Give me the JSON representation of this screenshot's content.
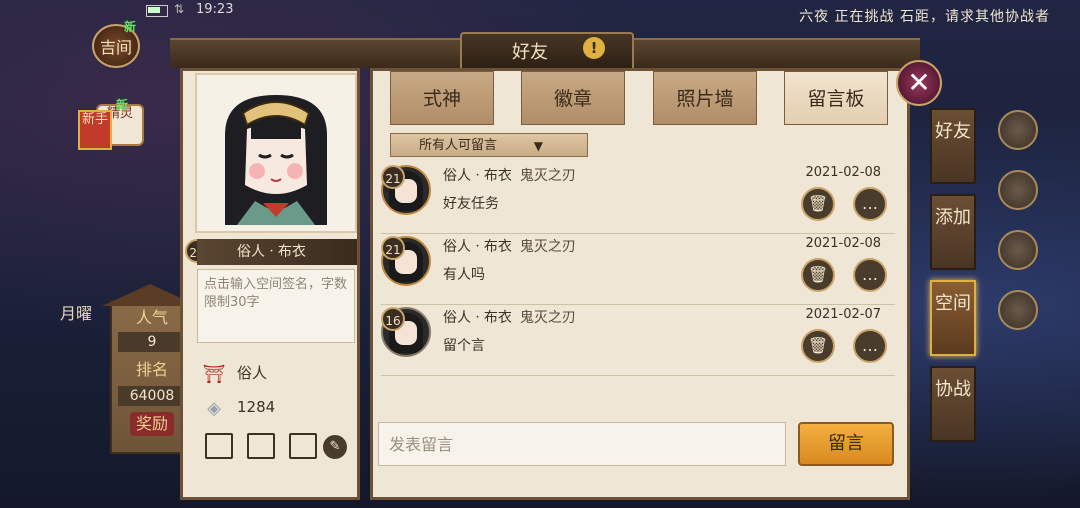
{
  "status_bar": {
    "time": "19:23"
  },
  "ticker": "六夜 正在挑战 石距，请求其他协战者",
  "left_hud": {
    "jijian": "吉间",
    "new_badge": "新",
    "jingling": "精灵",
    "xinshou": "新手",
    "weekday": "月曜",
    "popularity_label": "人气",
    "popularity_value": "9",
    "rank_label": "排名",
    "rank_value": "64008",
    "reward_label": "奖励"
  },
  "window": {
    "title": "好友",
    "alert_icon": "!",
    "close_icon": "✕"
  },
  "profile": {
    "level": "21",
    "name": "俗人ㆍ布衣",
    "signature_placeholder": "点击输入空间签名，字数限制30字",
    "rank_title": "俗人",
    "currency_value": "1284",
    "edit_icon": "✎"
  },
  "tabs": [
    {
      "label": "式神",
      "active": false
    },
    {
      "label": "徽章",
      "active": false
    },
    {
      "label": "照片墙",
      "active": false
    },
    {
      "label": "留言板",
      "active": true
    }
  ],
  "filter": {
    "label": "所有人可留言",
    "arrow": "▼"
  },
  "messages": [
    {
      "level": "21",
      "author": "俗人ㆍ布衣",
      "guild": "鬼灭之刃",
      "date": "2021-02-08",
      "text": "好友任务"
    },
    {
      "level": "21",
      "author": "俗人ㆍ布衣",
      "guild": "鬼灭之刃",
      "date": "2021-02-08",
      "text": "有人吗"
    },
    {
      "level": "16",
      "author": "俗人ㆍ布衣",
      "guild": "鬼灭之刃",
      "date": "2021-02-07",
      "text": "留个言"
    }
  ],
  "compose": {
    "placeholder": "发表留言",
    "send_label": "留言"
  },
  "side_tabs": [
    {
      "label": "好友",
      "active": false
    },
    {
      "label": "添加",
      "active": false
    },
    {
      "label": "空间",
      "active": true
    },
    {
      "label": "协战",
      "active": false
    }
  ]
}
